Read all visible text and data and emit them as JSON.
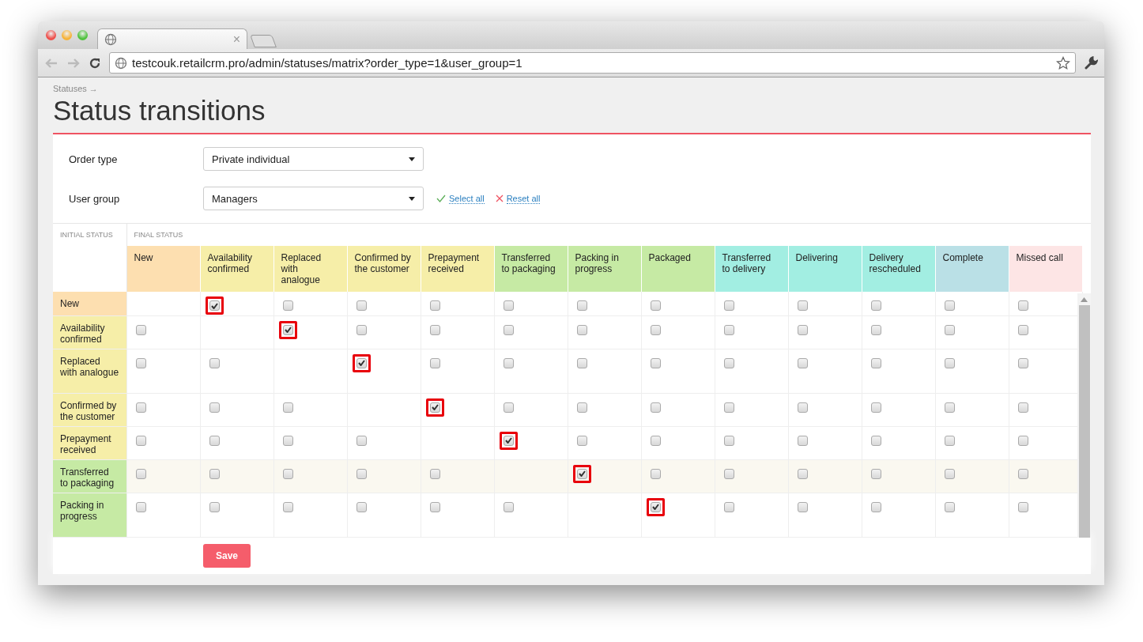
{
  "browser": {
    "tab_close": "×",
    "url": "testcouk.retailcrm.pro/admin/statuses/matrix?order_type=1&user_group=1"
  },
  "breadcrumb": "Statuses →",
  "title": "Status transitions",
  "filters": [
    {
      "label": "Order type",
      "value": "Private individual"
    },
    {
      "label": "User group",
      "value": "Managers"
    }
  ],
  "actions": [
    {
      "kind": "select",
      "label": "Select all"
    },
    {
      "kind": "reset",
      "label": "Reset all"
    }
  ],
  "matrix": {
    "initial_heading": "INITIAL STATUS",
    "final_heading": "FINAL STATUS",
    "columns": [
      {
        "label": "New",
        "color": "#fddfb0"
      },
      {
        "label": "Availability confirmed",
        "color": "#f6eea8"
      },
      {
        "label": "Replaced with analogue",
        "color": "#f6eea8"
      },
      {
        "label": "Confirmed by the customer",
        "color": "#f6eea8"
      },
      {
        "label": "Prepayment received",
        "color": "#f6eea8"
      },
      {
        "label": "Transferred to packaging",
        "color": "#c6eaa4"
      },
      {
        "label": "Packing in progress",
        "color": "#c6eaa4"
      },
      {
        "label": "Packaged",
        "color": "#c6eaa4"
      },
      {
        "label": "Transferred to delivery",
        "color": "#a2eee2"
      },
      {
        "label": "Delivering",
        "color": "#a2eee2"
      },
      {
        "label": "Delivery rescheduled",
        "color": "#a2eee2"
      },
      {
        "label": "Complete",
        "color": "#bae0e6"
      },
      {
        "label": "Missed call",
        "color": "#fde5e5"
      }
    ],
    "rows": [
      {
        "label": "New",
        "color": "#fddfb0",
        "hovered": false,
        "cells": [
          {
            "kind": "none"
          },
          {
            "kind": "checkbox",
            "checked": true,
            "highlighted": true
          },
          {
            "kind": "checkbox",
            "checked": false,
            "highlighted": false
          },
          {
            "kind": "checkbox",
            "checked": false,
            "highlighted": false
          },
          {
            "kind": "checkbox",
            "checked": false,
            "highlighted": false
          },
          {
            "kind": "checkbox",
            "checked": false,
            "highlighted": false
          },
          {
            "kind": "checkbox",
            "checked": false,
            "highlighted": false
          },
          {
            "kind": "checkbox",
            "checked": false,
            "highlighted": false
          },
          {
            "kind": "checkbox",
            "checked": false,
            "highlighted": false
          },
          {
            "kind": "checkbox",
            "checked": false,
            "highlighted": false
          },
          {
            "kind": "checkbox",
            "checked": false,
            "highlighted": false
          },
          {
            "kind": "checkbox",
            "checked": false,
            "highlighted": false
          },
          {
            "kind": "checkbox",
            "checked": false,
            "highlighted": false
          }
        ]
      },
      {
        "label": "Availability confirmed",
        "color": "#f6eea8",
        "hovered": false,
        "cells": [
          {
            "kind": "checkbox",
            "checked": false,
            "highlighted": false
          },
          {
            "kind": "none"
          },
          {
            "kind": "checkbox",
            "checked": true,
            "highlighted": true
          },
          {
            "kind": "checkbox",
            "checked": false,
            "highlighted": false
          },
          {
            "kind": "checkbox",
            "checked": false,
            "highlighted": false
          },
          {
            "kind": "checkbox",
            "checked": false,
            "highlighted": false
          },
          {
            "kind": "checkbox",
            "checked": false,
            "highlighted": false
          },
          {
            "kind": "checkbox",
            "checked": false,
            "highlighted": false
          },
          {
            "kind": "checkbox",
            "checked": false,
            "highlighted": false
          },
          {
            "kind": "checkbox",
            "checked": false,
            "highlighted": false
          },
          {
            "kind": "checkbox",
            "checked": false,
            "highlighted": false
          },
          {
            "kind": "checkbox",
            "checked": false,
            "highlighted": false
          },
          {
            "kind": "checkbox",
            "checked": false,
            "highlighted": false
          }
        ]
      },
      {
        "label": "Replaced with analogue",
        "color": "#f6eea8",
        "hovered": false,
        "cells": [
          {
            "kind": "checkbox",
            "checked": false,
            "highlighted": false
          },
          {
            "kind": "checkbox",
            "checked": false,
            "highlighted": false
          },
          {
            "kind": "none"
          },
          {
            "kind": "checkbox",
            "checked": true,
            "highlighted": true
          },
          {
            "kind": "checkbox",
            "checked": false,
            "highlighted": false
          },
          {
            "kind": "checkbox",
            "checked": false,
            "highlighted": false
          },
          {
            "kind": "checkbox",
            "checked": false,
            "highlighted": false
          },
          {
            "kind": "checkbox",
            "checked": false,
            "highlighted": false
          },
          {
            "kind": "checkbox",
            "checked": false,
            "highlighted": false
          },
          {
            "kind": "checkbox",
            "checked": false,
            "highlighted": false
          },
          {
            "kind": "checkbox",
            "checked": false,
            "highlighted": false
          },
          {
            "kind": "checkbox",
            "checked": false,
            "highlighted": false
          },
          {
            "kind": "checkbox",
            "checked": false,
            "highlighted": false
          }
        ]
      },
      {
        "label": "Confirmed by the customer",
        "color": "#f6eea8",
        "hovered": false,
        "cells": [
          {
            "kind": "checkbox",
            "checked": false,
            "highlighted": false
          },
          {
            "kind": "checkbox",
            "checked": false,
            "highlighted": false
          },
          {
            "kind": "checkbox",
            "checked": false,
            "highlighted": false
          },
          {
            "kind": "none"
          },
          {
            "kind": "checkbox",
            "checked": true,
            "highlighted": true
          },
          {
            "kind": "checkbox",
            "checked": false,
            "highlighted": false
          },
          {
            "kind": "checkbox",
            "checked": false,
            "highlighted": false
          },
          {
            "kind": "checkbox",
            "checked": false,
            "highlighted": false
          },
          {
            "kind": "checkbox",
            "checked": false,
            "highlighted": false
          },
          {
            "kind": "checkbox",
            "checked": false,
            "highlighted": false
          },
          {
            "kind": "checkbox",
            "checked": false,
            "highlighted": false
          },
          {
            "kind": "checkbox",
            "checked": false,
            "highlighted": false
          },
          {
            "kind": "checkbox",
            "checked": false,
            "highlighted": false
          }
        ]
      },
      {
        "label": "Prepayment received",
        "color": "#f6eea8",
        "hovered": false,
        "cells": [
          {
            "kind": "checkbox",
            "checked": false,
            "highlighted": false
          },
          {
            "kind": "checkbox",
            "checked": false,
            "highlighted": false
          },
          {
            "kind": "checkbox",
            "checked": false,
            "highlighted": false
          },
          {
            "kind": "checkbox",
            "checked": false,
            "highlighted": false
          },
          {
            "kind": "none"
          },
          {
            "kind": "checkbox",
            "checked": true,
            "highlighted": true
          },
          {
            "kind": "checkbox",
            "checked": false,
            "highlighted": false
          },
          {
            "kind": "checkbox",
            "checked": false,
            "highlighted": false
          },
          {
            "kind": "checkbox",
            "checked": false,
            "highlighted": false
          },
          {
            "kind": "checkbox",
            "checked": false,
            "highlighted": false
          },
          {
            "kind": "checkbox",
            "checked": false,
            "highlighted": false
          },
          {
            "kind": "checkbox",
            "checked": false,
            "highlighted": false
          },
          {
            "kind": "checkbox",
            "checked": false,
            "highlighted": false
          }
        ]
      },
      {
        "label": "Transferred to packaging",
        "color": "#c6eaa4",
        "hovered": true,
        "cells": [
          {
            "kind": "checkbox",
            "checked": false,
            "highlighted": false
          },
          {
            "kind": "checkbox",
            "checked": false,
            "highlighted": false
          },
          {
            "kind": "checkbox",
            "checked": false,
            "highlighted": false
          },
          {
            "kind": "checkbox",
            "checked": false,
            "highlighted": false
          },
          {
            "kind": "checkbox",
            "checked": false,
            "highlighted": false
          },
          {
            "kind": "none"
          },
          {
            "kind": "checkbox",
            "checked": true,
            "highlighted": true
          },
          {
            "kind": "checkbox",
            "checked": false,
            "highlighted": false
          },
          {
            "kind": "checkbox",
            "checked": false,
            "highlighted": false
          },
          {
            "kind": "checkbox",
            "checked": false,
            "highlighted": false
          },
          {
            "kind": "checkbox",
            "checked": false,
            "highlighted": false
          },
          {
            "kind": "checkbox",
            "checked": false,
            "highlighted": false
          },
          {
            "kind": "checkbox",
            "checked": false,
            "highlighted": false
          }
        ]
      },
      {
        "label": "Packing in progress",
        "color": "#c6eaa4",
        "hovered": false,
        "cells": [
          {
            "kind": "checkbox",
            "checked": false,
            "highlighted": false
          },
          {
            "kind": "checkbox",
            "checked": false,
            "highlighted": false
          },
          {
            "kind": "checkbox",
            "checked": false,
            "highlighted": false
          },
          {
            "kind": "checkbox",
            "checked": false,
            "highlighted": false
          },
          {
            "kind": "checkbox",
            "checked": false,
            "highlighted": false
          },
          {
            "kind": "checkbox",
            "checked": false,
            "highlighted": false
          },
          {
            "kind": "none"
          },
          {
            "kind": "checkbox",
            "checked": true,
            "highlighted": true
          },
          {
            "kind": "checkbox",
            "checked": false,
            "highlighted": false
          },
          {
            "kind": "checkbox",
            "checked": false,
            "highlighted": false
          },
          {
            "kind": "checkbox",
            "checked": false,
            "highlighted": false
          },
          {
            "kind": "checkbox",
            "checked": false,
            "highlighted": false
          },
          {
            "kind": "checkbox",
            "checked": false,
            "highlighted": false
          }
        ]
      }
    ]
  },
  "save_button": "Save"
}
